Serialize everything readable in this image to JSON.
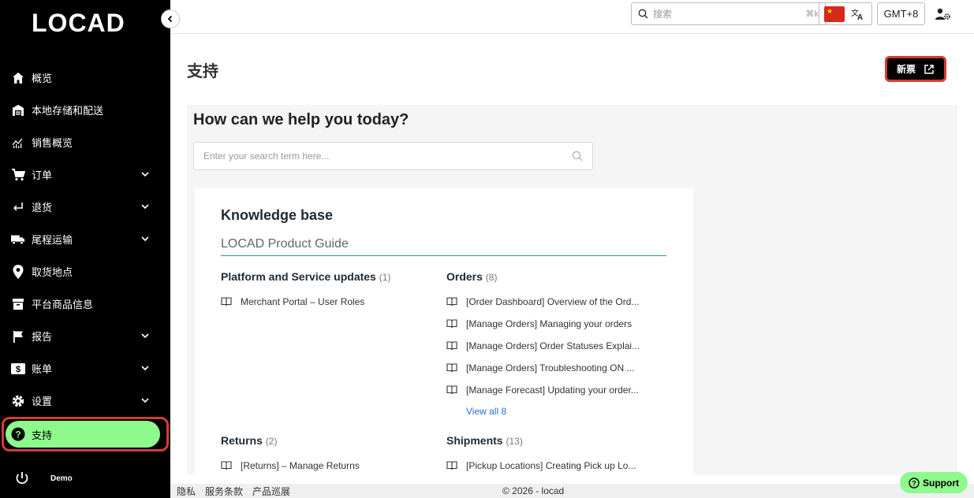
{
  "brand": {
    "logo_text": "LOCAD",
    "accent": "#8ef98c",
    "highlight": "#d43d2e"
  },
  "sidebar": {
    "items": [
      {
        "label": "概览",
        "icon": "home-icon",
        "chevron": false
      },
      {
        "label": "本地存储和配送",
        "icon": "warehouse-icon",
        "chevron": false
      },
      {
        "label": "销售概览",
        "icon": "chart-icon",
        "chevron": false
      },
      {
        "label": "订单",
        "icon": "cart-icon",
        "chevron": true
      },
      {
        "label": "退货",
        "icon": "return-arrow-icon",
        "chevron": true
      },
      {
        "label": "尾程运输",
        "icon": "truck-icon",
        "chevron": true
      },
      {
        "label": "取货地点",
        "icon": "location-pin-icon",
        "chevron": false
      },
      {
        "label": "平台商品信息",
        "icon": "archive-box-icon",
        "chevron": false
      },
      {
        "label": "报告",
        "icon": "flag-icon",
        "chevron": true
      },
      {
        "label": "账单",
        "icon": "billing-icon",
        "chevron": true
      },
      {
        "label": "设置",
        "icon": "gear-icon",
        "chevron": true
      },
      {
        "label": "支持",
        "icon": "help-circle-icon",
        "chevron": false,
        "active": true
      }
    ],
    "user": {
      "name": "Demo",
      "icon": "power-icon"
    }
  },
  "topbar": {
    "search_placeholder": "搜索",
    "search_shortcut": "⌘k",
    "language_flag": "china-flag-icon",
    "translate_icon": "translate-icon",
    "timezone": "GMT+8"
  },
  "main": {
    "page_title": "支持",
    "new_ticket_label": "新票",
    "help_title": "How can we help you today?",
    "kb_search_placeholder": "Enter your search term here...",
    "knowledge_base": {
      "title": "Knowledge base",
      "guide_tab": "LOCAD Product Guide",
      "sections": [
        {
          "title": "Platform and Service updates",
          "count": "(1)",
          "articles": [
            "Merchant Portal – User Roles"
          ]
        },
        {
          "title": "Orders",
          "count": "(8)",
          "articles": [
            "[Order Dashboard] Overview of the Ord...",
            "[Manage Orders] Managing your orders",
            "[Manage Orders] Order Statuses Explai...",
            "[Manage Orders] Troubleshooting ON ...",
            "[Manage Forecast] Updating your order..."
          ],
          "view_all": "View all 8"
        },
        {
          "title": "Returns",
          "count": "(2)",
          "articles": [
            "[Returns] – Manage Returns"
          ]
        },
        {
          "title": "Shipments",
          "count": "(13)",
          "articles": [
            "[Pickup Locations] Creating Pick up Lo..."
          ]
        }
      ]
    }
  },
  "footer": {
    "links": [
      "隐私",
      "服务条款",
      "产品巡展"
    ],
    "copyright": "© 2026 - locad",
    "support_button": "Support"
  }
}
